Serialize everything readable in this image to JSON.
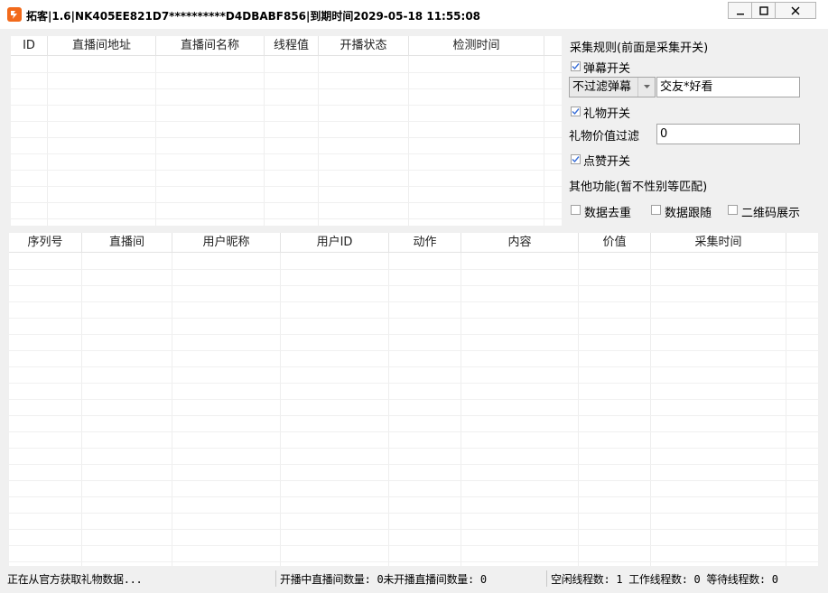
{
  "window": {
    "title": "拓客|1.6|NK405EE821D7**********D4DBABF856|到期时间2029-05-18 11:55:08",
    "icon": "app-logo-icon",
    "accent": "#f26a1b"
  },
  "room_table": {
    "columns": [
      "ID",
      "直播间地址",
      "直播间名称",
      "线程值",
      "开播状态",
      "检测时间"
    ],
    "rows": []
  },
  "rules": {
    "title": "采集规则(前面是采集开关)",
    "danmu": {
      "label": "弹幕开关",
      "checked": true
    },
    "filter_mode": {
      "selected": "不过滤弹幕"
    },
    "filter_keyword": {
      "value": "交友*好看"
    },
    "gift": {
      "label": "礼物开关",
      "checked": true
    },
    "gift_filter": {
      "label": "礼物价值过滤",
      "value": "0"
    },
    "like": {
      "label": "点赞开关",
      "checked": true
    },
    "other_title": "其他功能(暂不性别等匹配)",
    "dedupe": {
      "label": "数据去重",
      "checked": false
    },
    "follow": {
      "label": "数据跟随",
      "checked": false
    },
    "qrcode": {
      "label": "二维码展示",
      "checked": false
    }
  },
  "data_table": {
    "columns": [
      "序列号",
      "直播间",
      "用户昵称",
      "用户ID",
      "动作",
      "内容",
      "价值",
      "采集时间"
    ],
    "rows": []
  },
  "status": {
    "message": "正在从官方获取礼物数据...",
    "rooms": "开播中直播间数量: 0未开播直播间数量: 0",
    "threads": "空闲线程数: 1  工作线程数: 0 等待线程数: 0"
  }
}
